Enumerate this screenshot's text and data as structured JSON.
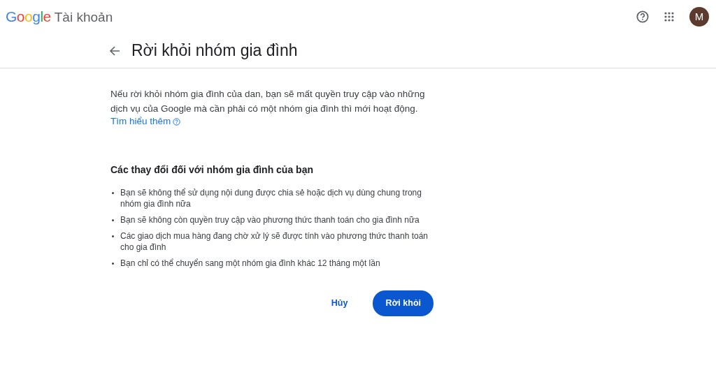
{
  "header": {
    "logo": "Google",
    "product": "Tài khoản",
    "avatar": "M"
  },
  "page": {
    "title": "Rời khỏi nhóm gia đình"
  },
  "intro": {
    "text": "Nếu rời khỏi nhóm gia đình của dan, bạn sẽ mất quyền truy cập vào những dịch vụ của Google mà cần phải có một nhóm gia đình thì mới hoạt động.",
    "link": "Tìm hiểu thêm"
  },
  "changes": {
    "heading": "Các thay đổi đối với nhóm gia đình của bạn",
    "items": [
      "Bạn sẽ không thể sử dụng nội dung được chia sẻ hoặc dịch vụ dùng chung trong nhóm gia đình nữa",
      "Bạn sẽ không còn quyền truy cập vào phương thức thanh toán cho gia đình nữa",
      "Các giao dịch mua hàng đang chờ xử lý sẽ được tính vào phương thức thanh toán cho gia đình",
      "Bạn chỉ có thể chuyển sang một nhóm gia đình khác 12 tháng một lần"
    ]
  },
  "buttons": {
    "cancel": "Hủy",
    "leave": "Rời khỏi"
  }
}
